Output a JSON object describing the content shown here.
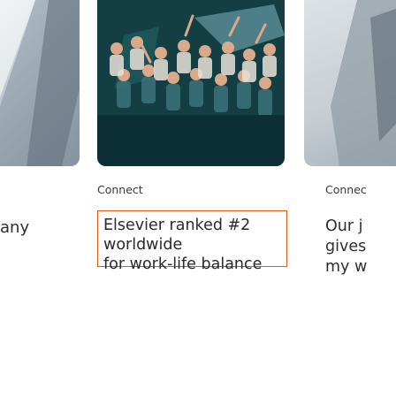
{
  "cards": [
    {
      "image_alt": "blurred building photo",
      "category": "",
      "title_lines": [
        "any"
      ]
    },
    {
      "image_alt": "group of people posing with arms raised",
      "category": "Connect",
      "title_lines": [
        "Elsevier ranked #2 worldwide",
        "for work-life balance"
      ]
    },
    {
      "image_alt": "partial photo",
      "category": "Connec",
      "title_lines": [
        "Our j",
        "gives",
        "my w"
      ]
    }
  ],
  "colors": {
    "focus_outline": "#e05a14",
    "text": "#2e2e2e",
    "photo_dark": "#0c2d33"
  }
}
